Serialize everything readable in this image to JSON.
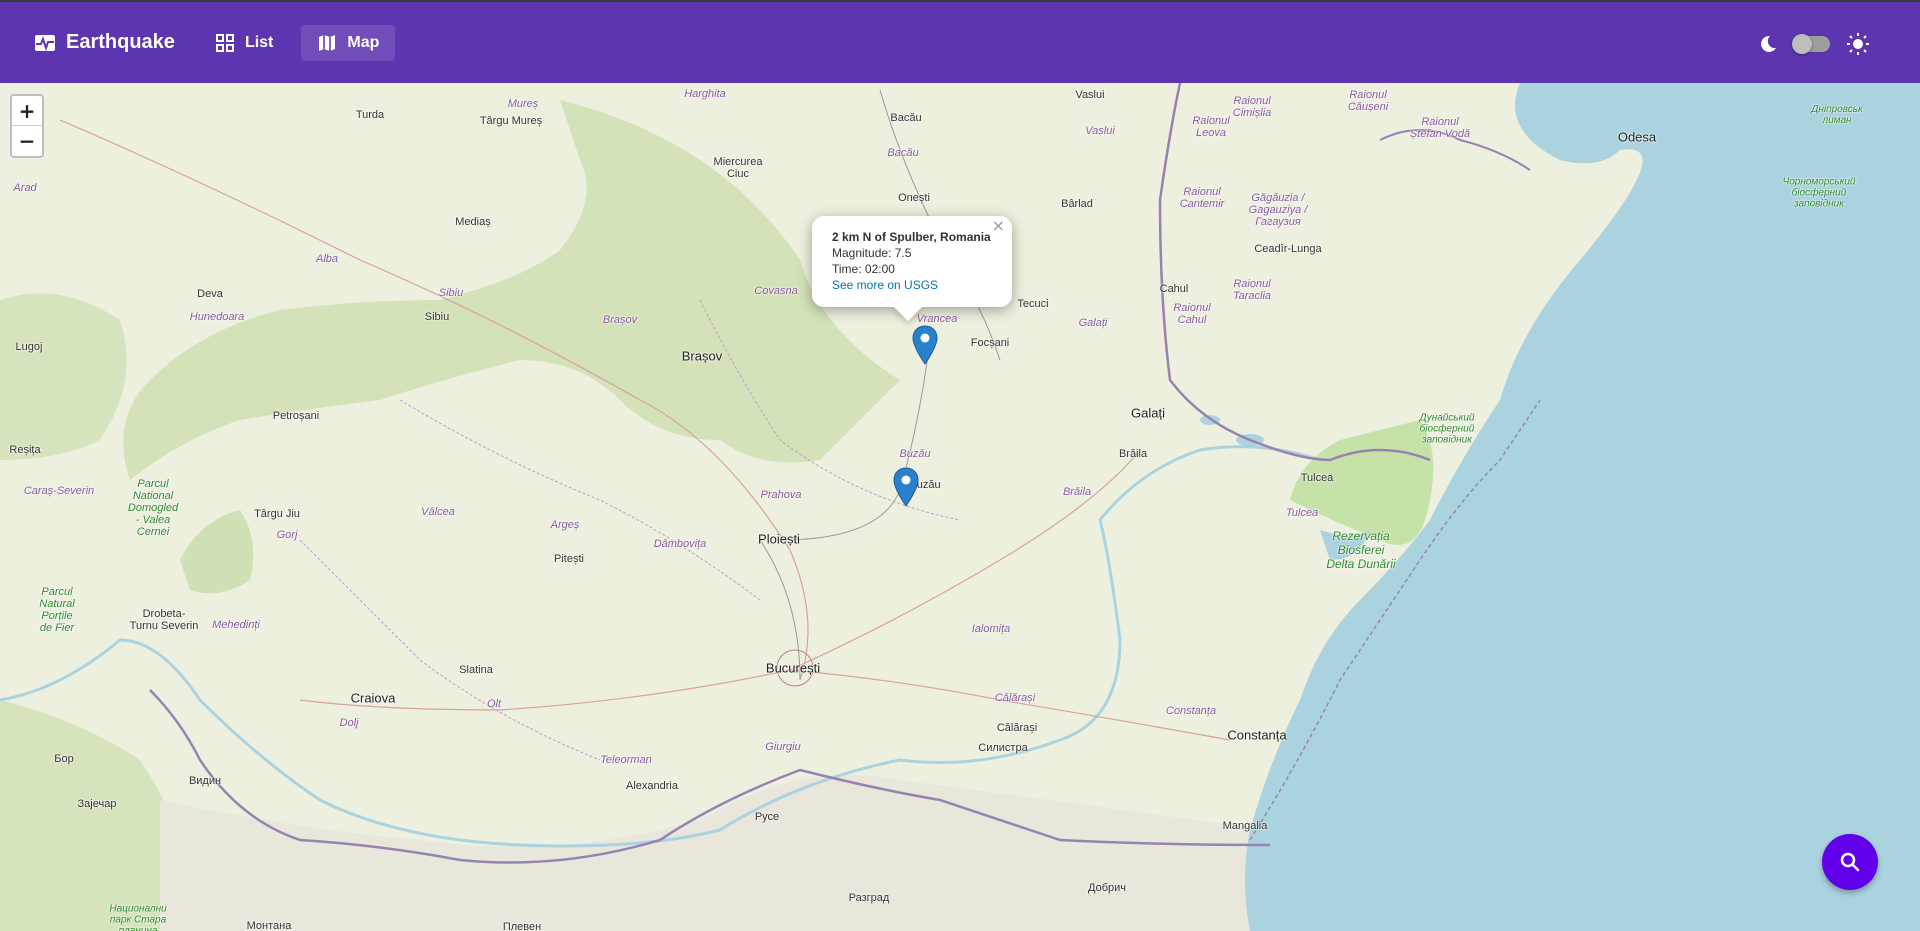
{
  "header": {
    "brand_label": "Earthquake",
    "nav": [
      {
        "label": "List",
        "icon": "grid-icon",
        "active": false
      },
      {
        "label": "Map",
        "icon": "map-icon",
        "active": true
      }
    ],
    "theme_toggle": {
      "left_icon": "moon-icon",
      "right_icon": "sun-icon",
      "state": "off"
    }
  },
  "map": {
    "zoom_in_label": "+",
    "zoom_out_label": "−",
    "places": {
      "ro_brasov": "Brașov",
      "ro_ploiesti": "Ploiești",
      "ro_bucuresti": "București",
      "ro_galati": "Galați",
      "ro_braila": "Brăila",
      "ro_constanta": "Constanța",
      "ro_craiova": "Craiova",
      "ro_buzau": "Buzău",
      "ro_focsani": "Focșani",
      "ro_bacau": "Bacău",
      "ro_tulcea": "Tulcea",
      "ro_pitesti": "Pitești",
      "ro_slatina": "Slatina",
      "ro_sibiu": "Sibiu",
      "ro_medias": "Mediaș",
      "ro_deva": "Deva",
      "ro_petrosani": "Petroșani",
      "ro_targujiu": "Târgu Jiu",
      "ro_drobeta": "Drobeta-\nTurnu Severin",
      "ro_resita": "Reșița",
      "ro_lugoj": "Lugoj",
      "ro_turda": "Turda",
      "ro_targumures": "Târgu Mureș",
      "ro_miercurea": "Miercurea\nCiuc",
      "ro_onesti": "Onești",
      "ro_vaslui": "Vaslui",
      "ro_barlad": "Bârlad",
      "ro_tecuci": "Tecuci",
      "ro_calarasi": "Călărași",
      "ro_alexandria": "Alexandria",
      "ro_mangalia": "Mangalia",
      "md_cahul": "Cahul",
      "md_ceadir": "Ceadîr-Lunga",
      "ua_odesa": "Odesa",
      "bg_silistra": "Силистра",
      "bg_ruse": "Русе",
      "bg_razgrad": "Разград",
      "bg_dobrich": "Добрич",
      "bg_vidin": "Видин",
      "bg_montana": "Монтана",
      "bg_pleven": "Плевен",
      "rs_zajecar": "Зајечар",
      "rs_bor": "Бор"
    },
    "regions": {
      "harghita": "Harghita",
      "mures": "Mureș",
      "bacau": "Bacău",
      "vaslui": "Vaslui",
      "covasna": "Covasna",
      "brasov": "Brașov",
      "vrancea": "Vrancea",
      "galati": "Galați",
      "buzau": "Buzău",
      "braila": "Brăila",
      "prahova": "Prahova",
      "arges": "Argeș",
      "dambovita": "Dâmbovița",
      "valcea": "Vâlcea",
      "gorj": "Gorj",
      "sibiu": "Sibiu",
      "alba": "Alba",
      "hunedoara": "Hunedoara",
      "caras": "Caraș-Severin",
      "mehedinti": "Mehedinți",
      "dolj": "Dolj",
      "olt": "Olt",
      "teleorman": "Teleorman",
      "giurgiu": "Giurgiu",
      "ialomita": "Ialomița",
      "calarasi": "Călărași",
      "constanta": "Constanța",
      "tulcea": "Tulcea",
      "arad": "Arad",
      "cimislia": "Raionul\nCimișlia",
      "causeni": "Raionul\nCăușeni",
      "stefanvoda": "Raionul\nȘtefan Vodă",
      "leova": "Raionul\nLeova",
      "cantemir": "Raionul\nCantemir",
      "gagauzia": "Găgăuzia /\nGagauziya /\nГагаузия",
      "taraclia": "Raionul\nTaraclia",
      "cahul": "Raionul\nCahul"
    },
    "parks": {
      "domogled": "Parcul\nNational\nDomogled\n- Valea\nCernei",
      "portile": "Parcul\nNatural\nPorțile\nde Fier",
      "delta": "Rezervația\nBiosferei\nDelta Dunării",
      "dunai": "Дунайський\nбіосферний\nзаповідник",
      "chorno": "Чорноморський\nбіосферний\nзаповідник",
      "dnipro": "Дніпровськ\nлиман",
      "stara": "Национални\nпарк Стара\nпланина"
    }
  },
  "popup": {
    "title": "2 km N of Spulber, Romania",
    "magnitude": "Magnitude: 7.5",
    "time": "Time: 02:00",
    "link": "See more on USGS",
    "close": "×"
  },
  "search_fab": {
    "icon": "search-icon"
  },
  "colors": {
    "header": "#5e35b1",
    "fab": "#6200ea",
    "marker": "#2a81cb",
    "sea": "#aad3df",
    "land": "#eef0df",
    "forest": "#c8ddb0"
  }
}
